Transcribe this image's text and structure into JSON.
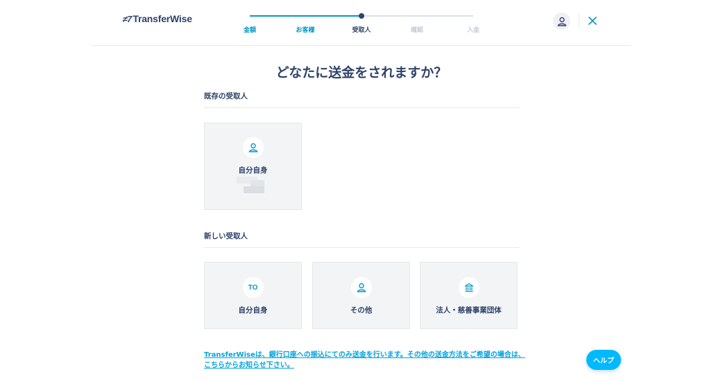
{
  "brand": {
    "logo_mark": "≠7",
    "logo_text": "TransferWise"
  },
  "stepper": {
    "steps": [
      {
        "label": "金額",
        "state": "done"
      },
      {
        "label": "お客様",
        "state": "done"
      },
      {
        "label": "受取人",
        "state": "active"
      },
      {
        "label": "確認",
        "state": "todo"
      },
      {
        "label": "入金",
        "state": "todo"
      }
    ]
  },
  "header": {
    "account_icon": "user-icon",
    "close_icon": "close-icon"
  },
  "main": {
    "title": "どなたに送金をされますか？",
    "existing": {
      "heading": "既存の受取人",
      "cards": [
        {
          "label": "自分自身",
          "icon": "user-icon"
        }
      ]
    },
    "new": {
      "heading": "新しい受取人",
      "cards": [
        {
          "label": "自分自身",
          "icon_text": "TO"
        },
        {
          "label": "その他",
          "icon": "user-icon"
        },
        {
          "label": "法人・慈善事業団体",
          "icon": "bank-icon"
        }
      ]
    },
    "footer_link": "TransferWiseは、銀行口座への振込にてのみ送金を行います。その他の送金方法をご希望の場合は、こちらからお知らせ下さい。"
  },
  "help_button": "ヘルプ",
  "colors": {
    "accent": "#0097c7",
    "navy": "#2e4369",
    "help": "#00b9ff",
    "link": "#00a2dd"
  }
}
